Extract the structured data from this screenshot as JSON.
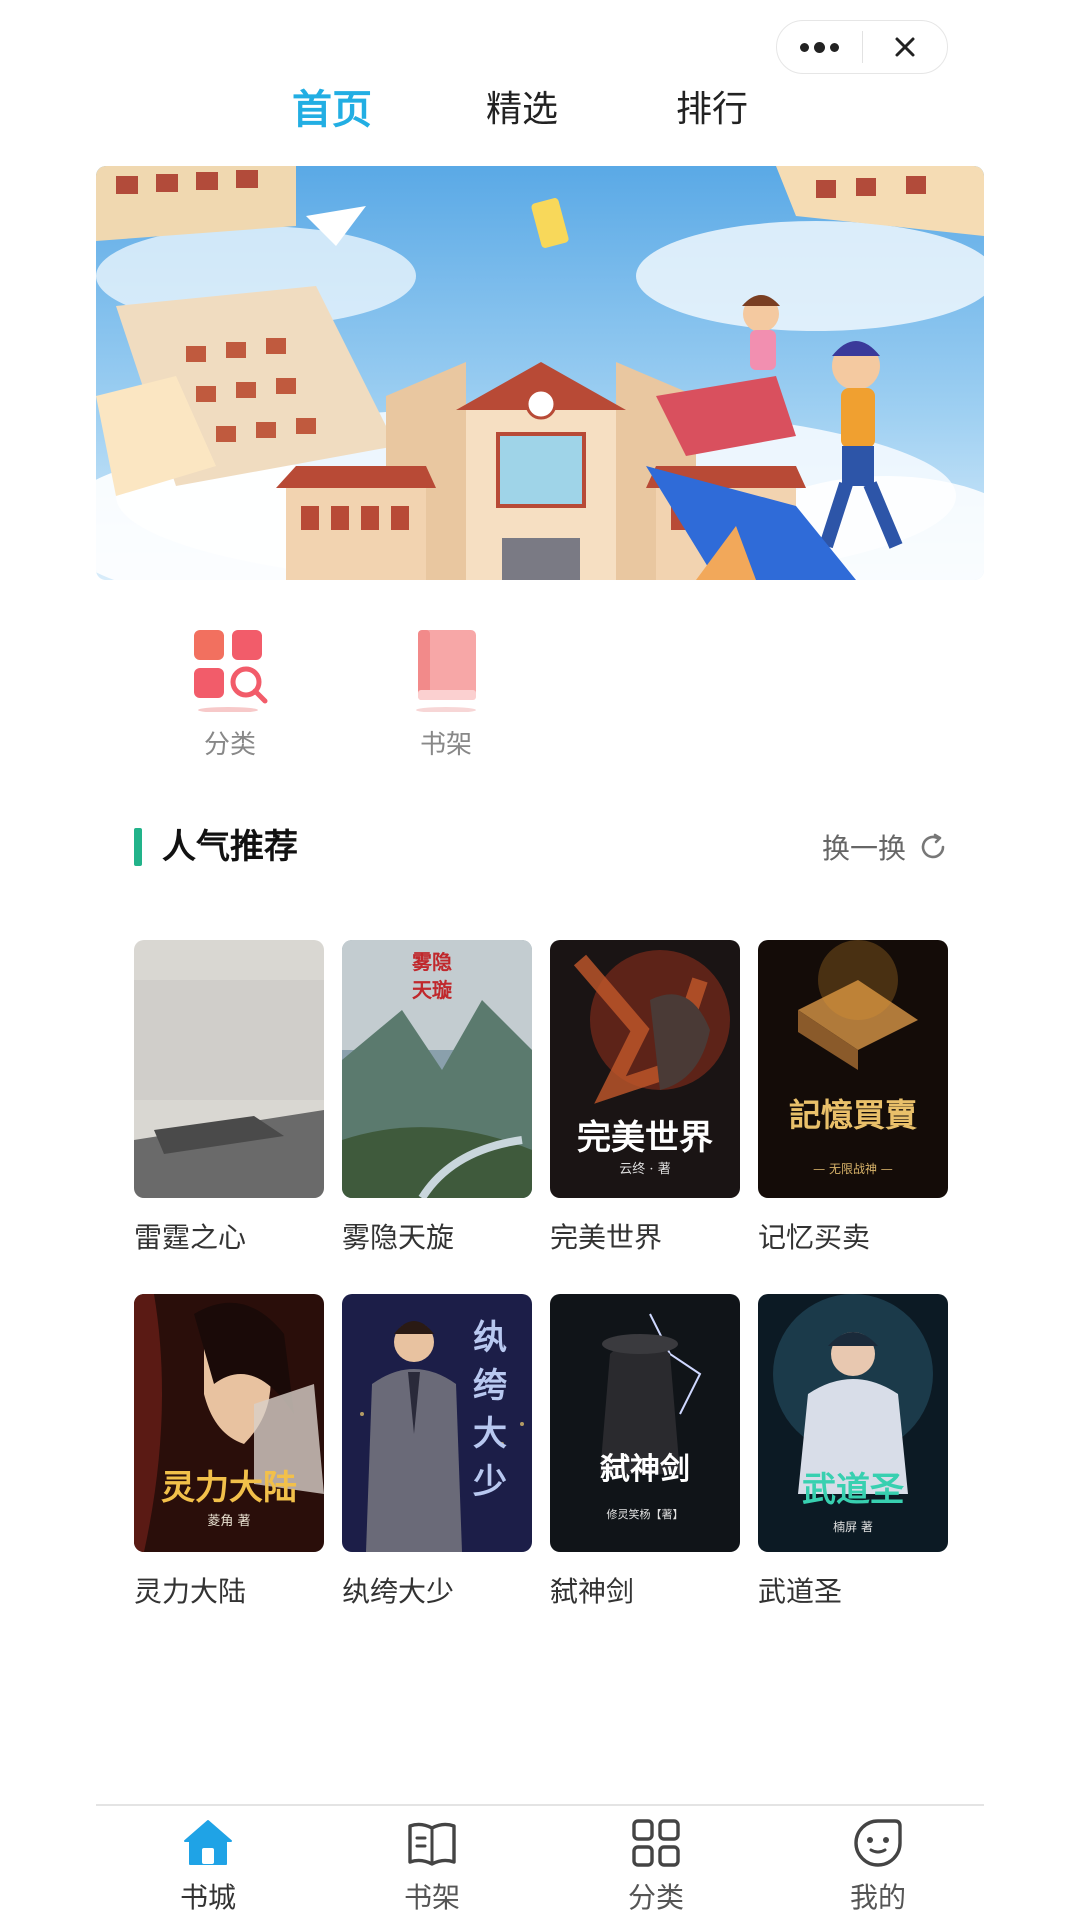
{
  "top_tabs": [
    {
      "label": "首页",
      "active": true
    },
    {
      "label": "精选",
      "active": false
    },
    {
      "label": "排行",
      "active": false
    }
  ],
  "quick_entries": [
    {
      "label": "分类",
      "icon": "category-search-icon"
    },
    {
      "label": "书架",
      "icon": "bookshelf-icon"
    }
  ],
  "section": {
    "title": "人气推荐",
    "refresh_label": "换一换",
    "accent_color": "#22b38a"
  },
  "books": [
    {
      "title": "雷霆之心",
      "cover_text": ""
    },
    {
      "title": "雾隐天旋",
      "cover_text": "雾隐天璇"
    },
    {
      "title": "完美世界",
      "cover_text": "完美世界",
      "cover_author": "云终 · 著"
    },
    {
      "title": "记忆买卖",
      "cover_text": "記憶買賣",
      "cover_author": "— 无限战神 —"
    },
    {
      "title": "灵力大陆",
      "cover_text": "灵力大陆",
      "cover_author": "菱角 著"
    },
    {
      "title": "纨绔大少",
      "cover_text": "纨绔大少"
    },
    {
      "title": "弑神剑",
      "cover_text": "弑神剑",
      "cover_author": "修灵笑杨【著】"
    },
    {
      "title": "武道圣",
      "cover_text": "武道圣",
      "cover_author": "楠屏 著"
    }
  ],
  "tabbar": [
    {
      "label": "书城",
      "icon": "home-icon",
      "active": true
    },
    {
      "label": "书架",
      "icon": "open-book-icon",
      "active": false
    },
    {
      "label": "分类",
      "icon": "grid-icon",
      "active": false
    },
    {
      "label": "我的",
      "icon": "smiley-face-icon",
      "active": false
    }
  ],
  "colors": {
    "active_tab": "#22aee3",
    "tabbar_active": "#1fa3e6"
  }
}
